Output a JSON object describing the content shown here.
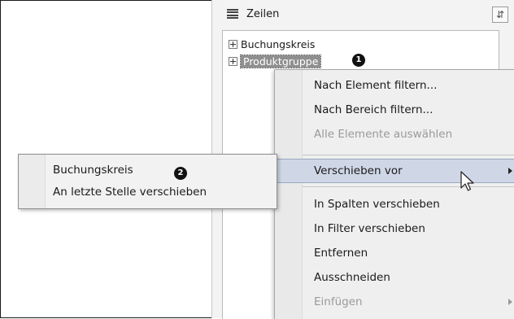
{
  "zeilen_section": {
    "title": "Zeilen",
    "icon": "rows-list-icon",
    "header_button_icon": "field-list-layout-icon"
  },
  "tree": {
    "items": [
      {
        "label": "Buchungskreis",
        "expander": "plus",
        "selected": false
      },
      {
        "label": "Produktgruppe",
        "expander": "plus",
        "selected": true
      }
    ]
  },
  "callouts": {
    "one": "1",
    "two": "2"
  },
  "context_menu": {
    "items": [
      {
        "label": "Nach Element filtern...",
        "disabled": false,
        "submenu": false
      },
      {
        "label": "Nach Bereich filtern...",
        "disabled": false,
        "submenu": false
      },
      {
        "label": "Alle Elemente auswählen",
        "disabled": true,
        "submenu": false
      },
      {
        "label": "Verschieben vor",
        "disabled": false,
        "submenu": true,
        "highlighted": true
      },
      {
        "label": "In Spalten verschieben",
        "disabled": false,
        "submenu": false
      },
      {
        "label": "In Filter verschieben",
        "disabled": false,
        "submenu": false
      },
      {
        "label": "Entfernen",
        "disabled": false,
        "submenu": false
      },
      {
        "label": "Ausschneiden",
        "disabled": false,
        "submenu": false
      },
      {
        "label": "Einfügen",
        "disabled": true,
        "submenu": true
      }
    ]
  },
  "submenu": {
    "items": [
      {
        "label": "Buchungskreis"
      },
      {
        "label": "An letzte Stelle verschieben"
      }
    ]
  },
  "colors": {
    "selection_bg": "#8f8f8f",
    "menu_hover": "#cfd7e6",
    "disabled_text": "#9a9a9a"
  }
}
